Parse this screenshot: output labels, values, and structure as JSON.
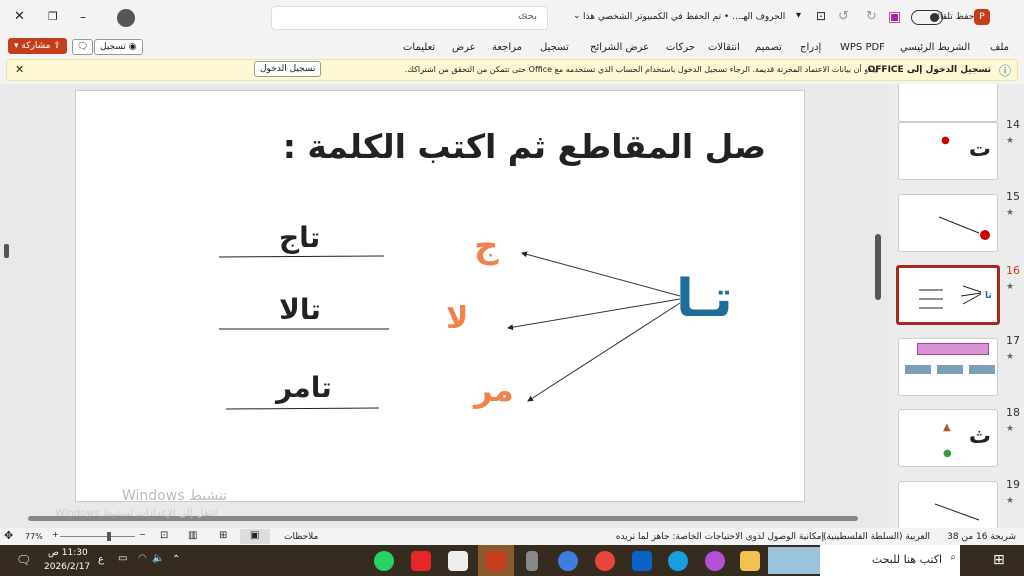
{
  "titlebar": {
    "autosave_label": "حفظ تلقائي",
    "doc_title": "الحروف الهـ... • تم الحفظ في الكمبيوتر الشخصي هذا",
    "search_placeholder": "بحث"
  },
  "ribbon": {
    "tabs": [
      "ملف",
      "الشريط الرئيسي",
      "WPS PDF",
      "إدراج",
      "تصميم",
      "انتقالات",
      "حركات",
      "عرض الشرائح",
      "تسجيل",
      "مراجعة",
      "عرض",
      "تعليمات"
    ],
    "record_button": "تسجيل",
    "share_button": "مشاركة"
  },
  "notification": {
    "title": "تسجيل الدخول إلى OFFICE",
    "message": "يبدو أن بيانات الاعتماد المخزنة قديمة. الرجاء تسجيل الدخول باستخدام الحساب الذي تستخدمه مع Office حتى تتمكن من التحقق من اشتراكك.",
    "signin_button": "تسجيل الدخول"
  },
  "slide": {
    "title": "صل المقاطع ثم اكتب الكلمة :",
    "source": "تـا",
    "syllables": [
      "ج",
      "لا",
      "مر"
    ],
    "words": [
      "تاج",
      "تالا",
      "تامر"
    ],
    "colors": {
      "source": "#1f6e99",
      "syllables": "#f0824a"
    }
  },
  "thumbnails": [
    {
      "number": "14"
    },
    {
      "number": "15"
    },
    {
      "number": "16",
      "selected": true
    },
    {
      "number": "17"
    },
    {
      "number": "18"
    },
    {
      "number": "19"
    }
  ],
  "watermark": {
    "line1": "تنشيط Windows",
    "line2": "انتقل إلى الإعدادات لتنشيط Windows"
  },
  "status": {
    "slide_counter": "شريحة 16 من 38",
    "language": "العربية (السلطة الفلسطينية)",
    "accessibility": "إمكانية الوصول لذوي الاحتياجات الخاصة: جاهز لما تريده",
    "notes": "ملاحظات",
    "zoom": "77%",
    "zoom_fraction": 0.62
  },
  "taskbar": {
    "search_placeholder": "اكتب هنا للبحث",
    "time": "11:30 ص",
    "date": "2026/2/17",
    "lang": "ع"
  }
}
